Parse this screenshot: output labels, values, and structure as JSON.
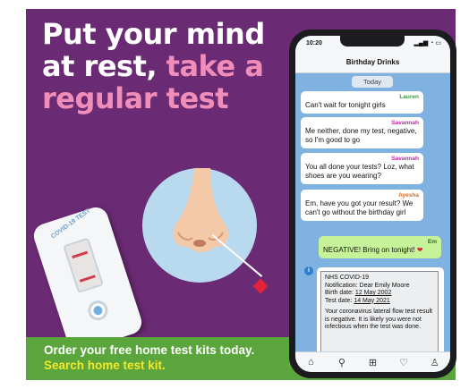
{
  "headline": {
    "line1": "Put your mind",
    "line2_white": "at rest,",
    "line2_pink": "take a",
    "line3_pink": "regular test"
  },
  "test_kit": {
    "label": "COVID-19 TEST"
  },
  "cta": {
    "text": "Order your free home test kits today.",
    "link": "Search home test kit."
  },
  "phone": {
    "time": "10:20",
    "status_icons": "▂▄▆ ◔ ▭",
    "chat_title": "Birthday Drinks",
    "day_label": "Today",
    "messages": [
      {
        "sender": "Lauren",
        "sender_color": "#3a9a3a",
        "text": "Can't wait for tonight girls"
      },
      {
        "sender": "Savannah",
        "sender_color": "#c0299a",
        "text": "Me neither, done my test, negative, so I'm good to go"
      },
      {
        "sender": "Savannah",
        "sender_color": "#c0299a",
        "text": "You all done your tests? Loz, what shoes are you wearing?"
      },
      {
        "sender": "Ayesha",
        "sender_color": "#e06a1a",
        "text": "Em, have you got your result? We can't go without the birthday girl"
      },
      {
        "sender": "Em",
        "sender_color": "#2d6a2d",
        "text": "NEGATIVE! Bring on tonight!",
        "emoji": "❤"
      }
    ],
    "notification": {
      "title": "NHS COVID-19",
      "line1": "Notification: Dear Emily Moore",
      "birth_label": "Birth date:",
      "birth_value": "12 May 2002",
      "test_label": "Test date:",
      "test_value": "14 May 2021",
      "body": "Your coronavirus lateral flow test result is negative. It is likely you were not infectious when the test was done."
    },
    "tabs": [
      "⌂",
      "⚲",
      "⊞",
      "♡",
      "♙"
    ]
  },
  "colors": {
    "background": "#6b2a74",
    "pink_accent": "#f08db8",
    "cta_green": "#5ba63c",
    "link_yellow": "#f4e82a",
    "chat_blue": "#7fb2e0",
    "my_bubble": "#c6f29a"
  }
}
